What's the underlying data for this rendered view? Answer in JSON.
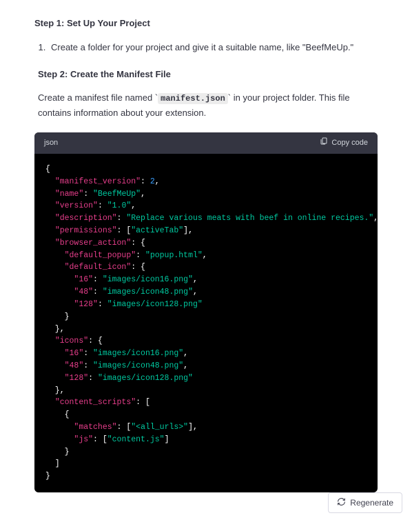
{
  "step1": {
    "heading": "Step 1: Set Up Your Project",
    "list_item": "Create a folder for your project and give it a suitable name, like \"BeefMeUp.\""
  },
  "step2": {
    "heading": "Step 2: Create the Manifest File",
    "para_before": "Create a manifest file named ",
    "inline_code": "manifest.json",
    "para_after": " in your project folder. This file contains information about your extension."
  },
  "code": {
    "language": "json",
    "copy_label": "Copy code",
    "manifest": {
      "manifest_version": 2,
      "name": "BeefMeUp",
      "version": "1.0",
      "description": "Replace various meats with beef in online recipes.",
      "permissions": [
        "activeTab"
      ],
      "browser_action": {
        "default_popup": "popup.html",
        "default_icon": {
          "16": "images/icon16.png",
          "48": "images/icon48.png",
          "128": "images/icon128.png"
        }
      },
      "icons": {
        "16": "images/icon16.png",
        "48": "images/icon48.png",
        "128": "images/icon128.png"
      },
      "content_scripts": [
        {
          "matches": [
            "<all_urls>"
          ],
          "js": [
            "content.js"
          ]
        }
      ]
    }
  },
  "regenerate_label": "Regenerate"
}
